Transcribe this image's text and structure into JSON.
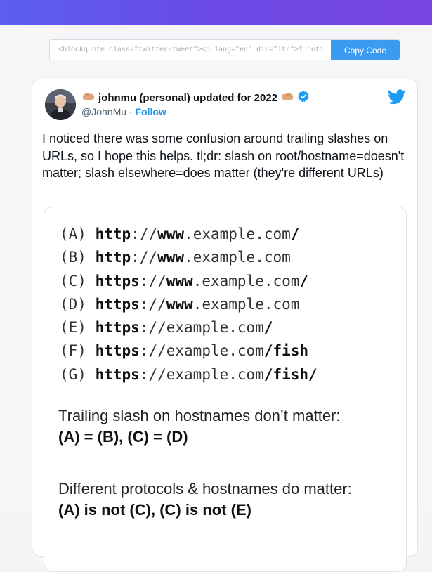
{
  "embed": {
    "input_value": "<blockquote class=\"twitter-tweet\"><p lang=\"en\" dir=\"ltr\">I noticed the",
    "copy_label": "Copy Code"
  },
  "tweet": {
    "display_name": "johnmu (personal) updated for 2022",
    "handle": "@JohnMu",
    "separator": "·",
    "follow_label": "Follow",
    "text": "I noticed there was some confusion around trailing slashes on URLs, so I hope this helps. tl;dr: slash on root/hostname=doesn't matter; slash elsewhere=does matter (they're different URLs)",
    "media": {
      "urls": [
        {
          "letter": "(A)",
          "scheme": "http",
          "sep": "://",
          "host": "www",
          "dot": ".",
          "domain": "example.com",
          "path": "/"
        },
        {
          "letter": "(B)",
          "scheme": "http",
          "sep": "://",
          "host": "www",
          "dot": ".",
          "domain": "example.com",
          "path": ""
        },
        {
          "letter": "(C)",
          "scheme": "https",
          "sep": "://",
          "host": "www",
          "dot": ".",
          "domain": "example.com",
          "path": "/"
        },
        {
          "letter": "(D)",
          "scheme": "https",
          "sep": "://",
          "host": "www",
          "dot": ".",
          "domain": "example.com",
          "path": ""
        },
        {
          "letter": "(E)",
          "scheme": "https",
          "sep": "://",
          "host": "",
          "dot": "",
          "domain": "example.com",
          "path": "/"
        },
        {
          "letter": "(F)",
          "scheme": "https",
          "sep": "://",
          "host": "",
          "dot": "",
          "domain": "example.com",
          "path": "/fish"
        },
        {
          "letter": "(G)",
          "scheme": "https",
          "sep": "://",
          "host": "",
          "dot": "",
          "domain": "example.com",
          "path": "/fish/"
        }
      ],
      "note1_title": "Trailing slash on hostnames don’t matter:",
      "note1_result": "(A) = (B), (C) = (D)",
      "note2_title": "Different protocols & hostnames do matter:",
      "note2_result": "(A) is not (C), (C) is not (E)"
    }
  },
  "colors": {
    "accent": "#1d9bf0",
    "topbar_start": "#5c5ff0",
    "topbar_end": "#7a45e0"
  },
  "icons": {
    "emoji": "bicep-emoji-icon",
    "verified": "verified-badge-icon",
    "logo": "twitter-bird-icon"
  }
}
